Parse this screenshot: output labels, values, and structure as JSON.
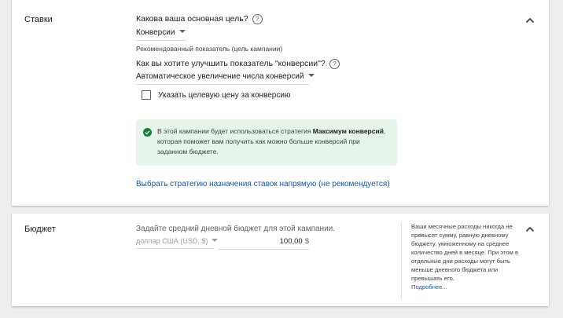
{
  "bids": {
    "title": "Ставки",
    "goal_question": "Какова ваша основная цель?",
    "goal_value": "Конверсии",
    "goal_hint": "Рекомендованный показатель (цель кампании)",
    "improve_question": "Как вы хотите улучшить показатель \"конверсии\"?",
    "improve_value": "Автоматическое увеличение числа конверсий",
    "target_price_label": "Указать целевую цену за конверсию",
    "info": {
      "before": "В этой кампании будет использоваться стратегия ",
      "bold": "Максимум конверсий",
      "after": ", которая поможет вам получить как можно больше конверсий при заданном бюджете."
    },
    "strategy_link": "Выбрать стратегию назначения ставок напрямую (не рекомендуется)"
  },
  "budget": {
    "title": "Бюджет",
    "question": "Задайте средний дневной бюджет для этой кампании.",
    "currency": "доллар США (USD, $)",
    "amount": "100,00",
    "unit": "$",
    "note": "Ваши месячные расходы никогда не превысят сумму, равную дневному бюджету, умноженному на среднее количество дней в месяце. При этом в отдельные дни расходы могут быть меньше дневного бюджета или превышать его.",
    "more_link": "Подробнее..."
  },
  "icons": {
    "help": "help-icon",
    "collapse": "chevron-up-icon",
    "success": "check-circle-icon",
    "dropdown": "caret-down-icon"
  },
  "colors": {
    "accent_link": "#1a56a8",
    "success_green": "#188038",
    "info_bg": "#e6f4ea"
  }
}
